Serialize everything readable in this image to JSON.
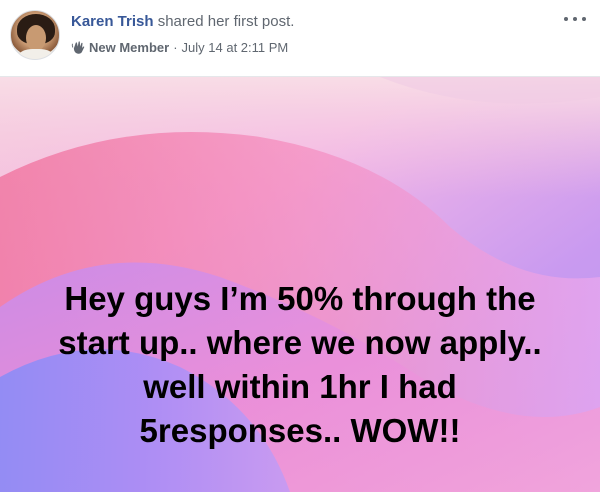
{
  "post": {
    "author": "Karen Trish",
    "action": " shared her first post.",
    "badge": "New Member",
    "separator": "·",
    "timestamp": "July 14 at 2:11 PM",
    "text": "Hey guys I’m 50% through the\nstart up.. where we now apply..\nwell within 1hr I had\n5responses.. WOW!!"
  },
  "icons": {
    "badge_icon": "waving-hand-icon",
    "menu_icon": "more-options-icon"
  },
  "colors": {
    "author_link": "#385898",
    "meta_text": "#606770",
    "post_text": "#000000"
  }
}
